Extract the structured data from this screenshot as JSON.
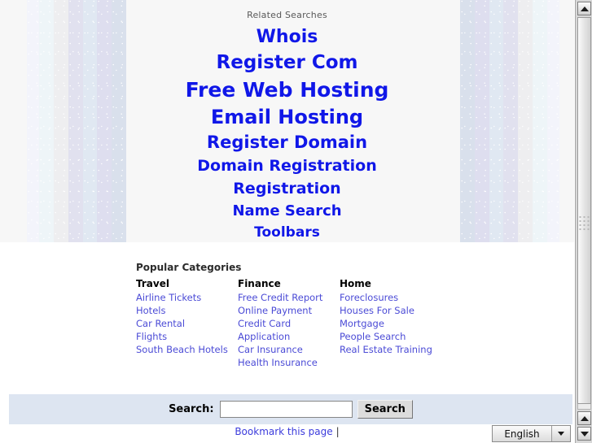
{
  "hero": {
    "title": "Related Searches",
    "links": [
      {
        "label": "Whois",
        "size": 22
      },
      {
        "label": "Register Com",
        "size": 23
      },
      {
        "label": "Free Web Hosting",
        "size": 25
      },
      {
        "label": "Email Hosting",
        "size": 24
      },
      {
        "label": "Register Domain",
        "size": 21
      },
      {
        "label": "Domain Registration",
        "size": 19
      },
      {
        "label": "Registration",
        "size": 19
      },
      {
        "label": "Name Search",
        "size": 18
      },
      {
        "label": "Toolbars",
        "size": 17
      }
    ],
    "stripes_left": [
      {
        "color": "#f3f4fb",
        "width": 15
      },
      {
        "color": "#eef5f8",
        "width": 18
      },
      {
        "color": "#eeeef0",
        "width": 18
      },
      {
        "color": "#e1e1ef",
        "width": 18
      },
      {
        "color": "#e0e8f2",
        "width": 17
      },
      {
        "color": "#dedeef",
        "width": 18
      },
      {
        "color": "#d9e0ec",
        "width": 18
      }
    ],
    "stripes_right": [
      {
        "color": "#d9e0ec",
        "width": 18
      },
      {
        "color": "#dedeef",
        "width": 18
      },
      {
        "color": "#e0e8f2",
        "width": 17
      },
      {
        "color": "#e1e1ef",
        "width": 18
      },
      {
        "color": "#eeeef0",
        "width": 18
      },
      {
        "color": "#eef5f8",
        "width": 18
      },
      {
        "color": "#f3f4fb",
        "width": 15
      }
    ]
  },
  "categories": {
    "title": "Popular Categories",
    "columns": [
      {
        "heading": "Travel",
        "links": [
          "Airline Tickets",
          "Hotels",
          "Car Rental",
          "Flights",
          "South Beach Hotels"
        ]
      },
      {
        "heading": "Finance",
        "links": [
          "Free Credit Report",
          "Online Payment",
          "Credit Card",
          "Application",
          "Car Insurance",
          "Health Insurance"
        ]
      },
      {
        "heading": "Home",
        "links": [
          "Foreclosures",
          "Houses For Sale",
          "Mortgage",
          "People Search",
          "Real Estate Training"
        ]
      }
    ]
  },
  "search": {
    "label": "Search:",
    "value": "",
    "placeholder": "",
    "button_label": "Search"
  },
  "footer": {
    "bookmark_label": "Bookmark this page",
    "separator": "|",
    "language_value": "English"
  },
  "colors": {
    "link_blue": "#1017e8",
    "category_link": "#4b4bd6",
    "band_blue": "#dde5f1",
    "hero_bg": "#f7f7f7"
  }
}
